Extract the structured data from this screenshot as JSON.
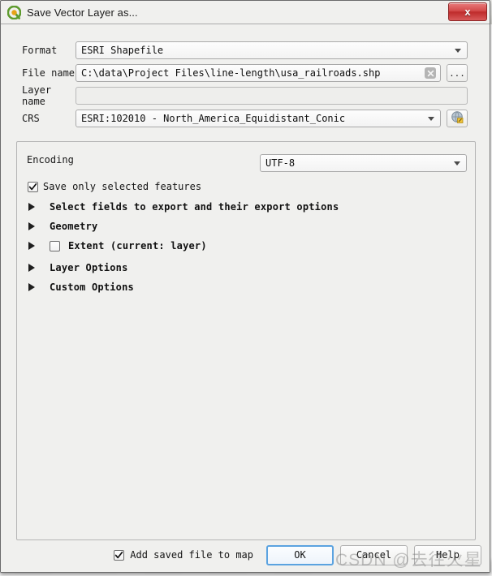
{
  "window": {
    "title": "Save Vector Layer as...",
    "logo_icon": "qgis-logo-icon",
    "close_label": "x"
  },
  "form": {
    "format": {
      "label": "Format",
      "value": "ESRI Shapefile",
      "dropdown_icon": "chevron-down-icon"
    },
    "file_name": {
      "label": "File name",
      "value": "C:\\data\\Project Files\\line-length\\usa_railroads.shp",
      "placeholder": "",
      "clear_icon": "clear-x-icon",
      "browse_label": "..."
    },
    "layer_name": {
      "label": "Layer name",
      "value": "",
      "placeholder": ""
    },
    "crs": {
      "label": "CRS",
      "value": "ESRI:102010 - North_America_Equidistant_Conic",
      "dropdown_icon": "chevron-down-icon",
      "select_crs_icon": "globe-edit-icon"
    }
  },
  "options": {
    "encoding": {
      "label": "Encoding",
      "value": "UTF-8",
      "dropdown_icon": "chevron-down-icon"
    },
    "save_only_selected": {
      "label": "Save only selected features",
      "checked": true
    },
    "sections": [
      {
        "label": "Select fields to export and their export options",
        "expanded": false,
        "has_checkbox": false,
        "checked": false
      },
      {
        "label": "Geometry",
        "expanded": false,
        "has_checkbox": false,
        "checked": false
      },
      {
        "label": "Extent (current: layer)",
        "expanded": false,
        "has_checkbox": true,
        "checked": false
      },
      {
        "label": "Layer Options",
        "expanded": false,
        "has_checkbox": false,
        "checked": false
      },
      {
        "label": "Custom Options",
        "expanded": false,
        "has_checkbox": false,
        "checked": false
      }
    ]
  },
  "footer": {
    "add_saved_file": {
      "label": "Add saved file to map",
      "checked": true
    },
    "ok_label": "OK",
    "cancel_label": "Cancel",
    "help_label": "Help"
  },
  "watermark": {
    "text": "CSDN @去往火星"
  },
  "colors": {
    "accent": "#5ba3e0",
    "close_red": "#bf2b2b",
    "dialog_bg": "#f0f0ee"
  }
}
